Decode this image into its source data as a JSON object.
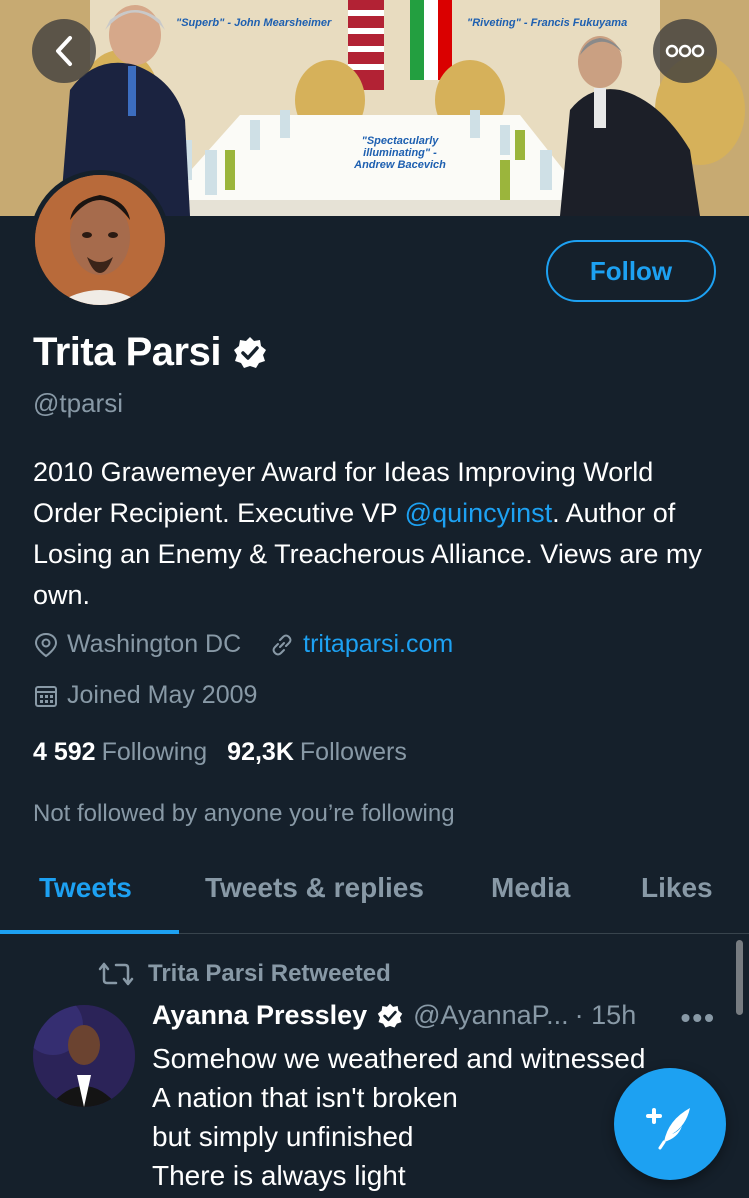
{
  "banner": {
    "quote_1": "\"Superb\" - John Mearsheimer",
    "quote_2": "\"Riveting\" - Francis Fukuyama",
    "quote_3_line1": "\"Spectacularly",
    "quote_3_line2": "illuminating\" -",
    "quote_3_line3": "Andrew Bacevich"
  },
  "header": {
    "back_icon": "chevron-left-icon",
    "more_icon": "ellipsis-icon"
  },
  "profile": {
    "name": "Trita Parsi",
    "verified": true,
    "handle": "@tparsi",
    "follow_label": "Follow",
    "bio_part1": "2010 Grawemeyer Award for Ideas Improving World Order Recipient. Executive VP ",
    "bio_link": "@quincyinst",
    "bio_part2": ". Author of Losing an Enemy & Treacherous Alliance. Views are my own.",
    "location": "Washington DC",
    "website": "tritaparsi.com",
    "joined": "Joined May 2009",
    "following_count": "4 592",
    "following_label": "Following",
    "followers_count": "92,3K",
    "followers_label": "Followers",
    "not_followed_text": "Not followed by anyone you’re following"
  },
  "tabs": [
    {
      "label": "Tweets",
      "active": true
    },
    {
      "label": "Tweets & replies",
      "active": false
    },
    {
      "label": "Media",
      "active": false
    },
    {
      "label": "Likes",
      "active": false
    }
  ],
  "tweet": {
    "retweet_label": "Trita Parsi Retweeted",
    "author_name": "Ayanna Pressley",
    "author_handle": "@AyannaP...",
    "time": "· 15h",
    "more": "•••",
    "lines": [
      "Somehow we weathered and witnessed",
      "A nation that isn't broken",
      "but simply unfinished",
      "There is always light"
    ]
  },
  "colors": {
    "background": "#15202b",
    "accent": "#1da1f2",
    "secondary_text": "#8899a6",
    "divider": "#38444d"
  },
  "fab_icon": "compose-tweet-icon"
}
